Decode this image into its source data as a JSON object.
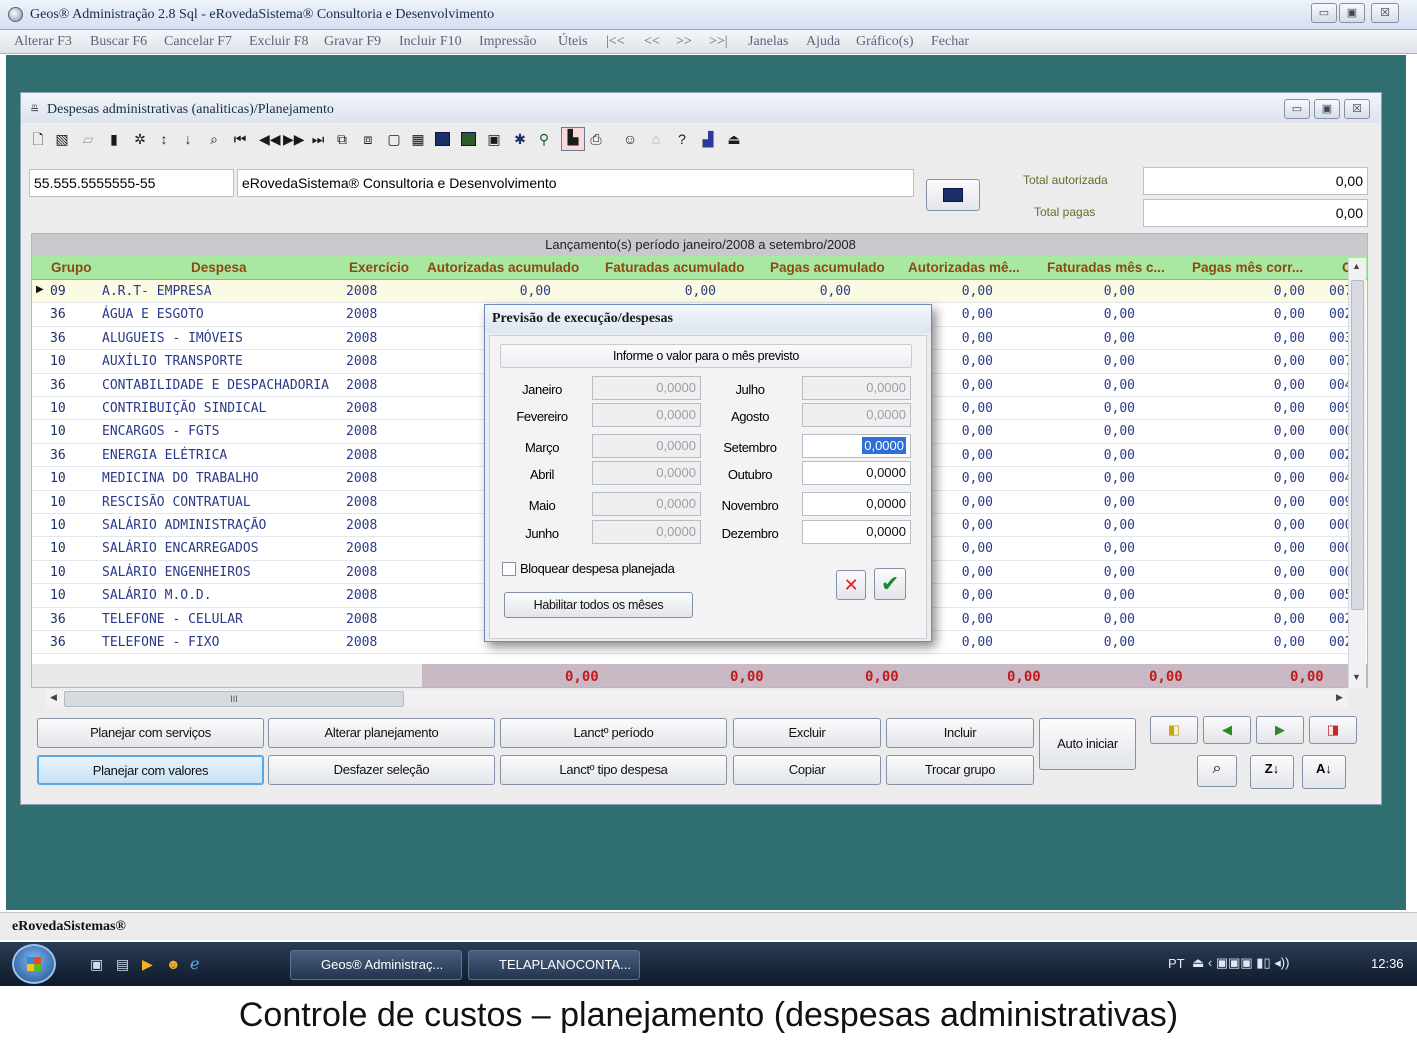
{
  "window": {
    "title": "Geos® Administração 2.8 Sql - eRovedaSistema® Consultoria e Desenvolvimento",
    "min": "▭",
    "max": "▣",
    "close": "☒"
  },
  "menu": [
    "Alterar F3",
    "Buscar F6",
    "Cancelar F7",
    "Excluir F8",
    "Gravar F9",
    "Incluir F10",
    "Impressão",
    "Úteis",
    "|<<",
    "<<",
    ">>",
    ">>|",
    "Janelas",
    "Ajuda",
    "Gráfico(s)",
    "Fechar"
  ],
  "child": {
    "title": "Despesas administrativas (analiticas)/Planejamento",
    "doc_number": "55.555.5555555-55",
    "company": "eRovedaSistema® Consultoria e Desenvolvimento",
    "total_autorizada_label": "Total autorizada",
    "total_autorizada": "0,00",
    "total_pagas_label": "Total pagas",
    "total_pagas": "0,00"
  },
  "grid": {
    "caption": "Lançamento(s) período janeiro/2008 a setembro/2008",
    "headers": [
      "Grupo",
      "Despesa",
      "Exercício",
      "Autorizadas acumulado",
      "Faturadas acumulado",
      "Pagas acumulado",
      "Autorizadas mê...",
      "Faturadas mês c...",
      "Pagas mês corr...",
      "C"
    ],
    "rows": [
      {
        "grupo": "09",
        "despesa": "A.R.T- EMPRESA",
        "ex": "2008",
        "aut": "0,00",
        "fat": "0,00",
        "pag": "0,00",
        "autm": "0,00",
        "fatm": "0,00",
        "pagm": "0,00",
        "c": "007"
      },
      {
        "grupo": "36",
        "despesa": "ÁGUA E ESGOTO",
        "ex": "2008",
        "autm": "0,00",
        "fatm": "0,00",
        "pagm": "0,00",
        "c": "002"
      },
      {
        "grupo": "36",
        "despesa": "ALUGUEIS - IMÓVEIS",
        "ex": "2008",
        "autm": "0,00",
        "fatm": "0,00",
        "pagm": "0,00",
        "c": "003"
      },
      {
        "grupo": "10",
        "despesa": "AUXÍLIO TRANSPORTE",
        "ex": "2008",
        "autm": "0,00",
        "fatm": "0,00",
        "pagm": "0,00",
        "c": "007"
      },
      {
        "grupo": "36",
        "despesa": "CONTABILIDADE E DESPACHADORIA",
        "ex": "2008",
        "autm": "0,00",
        "fatm": "0,00",
        "pagm": "0,00",
        "c": "004"
      },
      {
        "grupo": "10",
        "despesa": "CONTRIBUIÇÃO SINDICAL",
        "ex": "2008",
        "autm": "0,00",
        "fatm": "0,00",
        "pagm": "0,00",
        "c": "009"
      },
      {
        "grupo": "10",
        "despesa": "ENCARGOS - FGTS",
        "ex": "2008",
        "autm": "0,00",
        "fatm": "0,00",
        "pagm": "0,00",
        "c": "000"
      },
      {
        "grupo": "36",
        "despesa": "ENERGIA ELÉTRICA",
        "ex": "2008",
        "autm": "0,00",
        "fatm": "0,00",
        "pagm": "0,00",
        "c": "002"
      },
      {
        "grupo": "10",
        "despesa": "MEDICINA DO TRABALHO",
        "ex": "2008",
        "autm": "0,00",
        "fatm": "0,00",
        "pagm": "0,00",
        "c": "004"
      },
      {
        "grupo": "10",
        "despesa": "RESCISÃO CONTRATUAL",
        "ex": "2008",
        "autm": "0,00",
        "fatm": "0,00",
        "pagm": "0,00",
        "c": "009"
      },
      {
        "grupo": "10",
        "despesa": "SALÁRIO ADMINISTRAÇÃO",
        "ex": "2008",
        "autm": "0,00",
        "fatm": "0,00",
        "pagm": "0,00",
        "c": "000"
      },
      {
        "grupo": "10",
        "despesa": "SALÁRIO ENCARREGADOS",
        "ex": "2008",
        "autm": "0,00",
        "fatm": "0,00",
        "pagm": "0,00",
        "c": "000"
      },
      {
        "grupo": "10",
        "despesa": "SALÁRIO ENGENHEIROS",
        "ex": "2008",
        "autm": "0,00",
        "fatm": "0,00",
        "pagm": "0,00",
        "c": "000"
      },
      {
        "grupo": "10",
        "despesa": "SALÁRIO M.O.D.",
        "ex": "2008",
        "autm": "0,00",
        "fatm": "0,00",
        "pagm": "0,00",
        "c": "005"
      },
      {
        "grupo": "36",
        "despesa": "TELEFONE - CELULAR",
        "ex": "2008",
        "autm": "0,00",
        "fatm": "0,00",
        "pagm": "0,00",
        "c": "002"
      },
      {
        "grupo": "36",
        "despesa": "TELEFONE - FIXO",
        "ex": "2008",
        "autm": "0,00",
        "fatm": "0,00",
        "pagm": "0,00",
        "c": "002"
      }
    ],
    "totals": [
      "0,00",
      "0,00",
      "0,00",
      "0,00",
      "0,00",
      "0,00"
    ],
    "hscroll_mark": "III"
  },
  "buttons": {
    "planejar_servicos": "Planejar com serviços",
    "alterar_planejamento": "Alterar planejamento",
    "lanct_periodo": "Lanctº período",
    "excluir": "Excluir",
    "incluir": "Incluir",
    "auto_iniciar": "Auto iniciar",
    "planejar_valores": "Planejar com valores",
    "desfazer": "Desfazer seleção",
    "lanct_tipo": "Lanctº tipo despesa",
    "copiar": "Copiar",
    "trocar_grupo": "Trocar grupo"
  },
  "modal": {
    "title": "Previsão de execução/despesas",
    "header": "Informe o valor para o mês previsto",
    "months_left": [
      {
        "label": "Janeiro",
        "value": "0,0000"
      },
      {
        "label": "Fevereiro",
        "value": "0,0000"
      },
      {
        "label": "Março",
        "value": "0,0000"
      },
      {
        "label": "Abril",
        "value": "0,0000"
      },
      {
        "label": "Maio",
        "value": "0,0000"
      },
      {
        "label": "Junho",
        "value": "0,0000"
      }
    ],
    "months_right": [
      {
        "label": "Julho",
        "value": "0,0000"
      },
      {
        "label": "Agosto",
        "value": "0,0000"
      },
      {
        "label": "Setembro",
        "value": "0,0000"
      },
      {
        "label": "Outubro",
        "value": "0,0000"
      },
      {
        "label": "Novembro",
        "value": "0,0000"
      },
      {
        "label": "Dezembro",
        "value": "0,0000"
      }
    ],
    "checkbox_label": "Bloquear despesa planejada",
    "enable_all": "Habilitar todos os mêses",
    "cancel_glyph": "✕",
    "ok_glyph": "✔"
  },
  "status": "eRovedaSistemas®",
  "taskbar": {
    "tasks": [
      "Geos® Administraç...",
      "TELAPLANOCONTA..."
    ],
    "lang": "PT",
    "clock": "12:36"
  },
  "caption": "Controle de  custos – planejamento (despesas administrativas)"
}
